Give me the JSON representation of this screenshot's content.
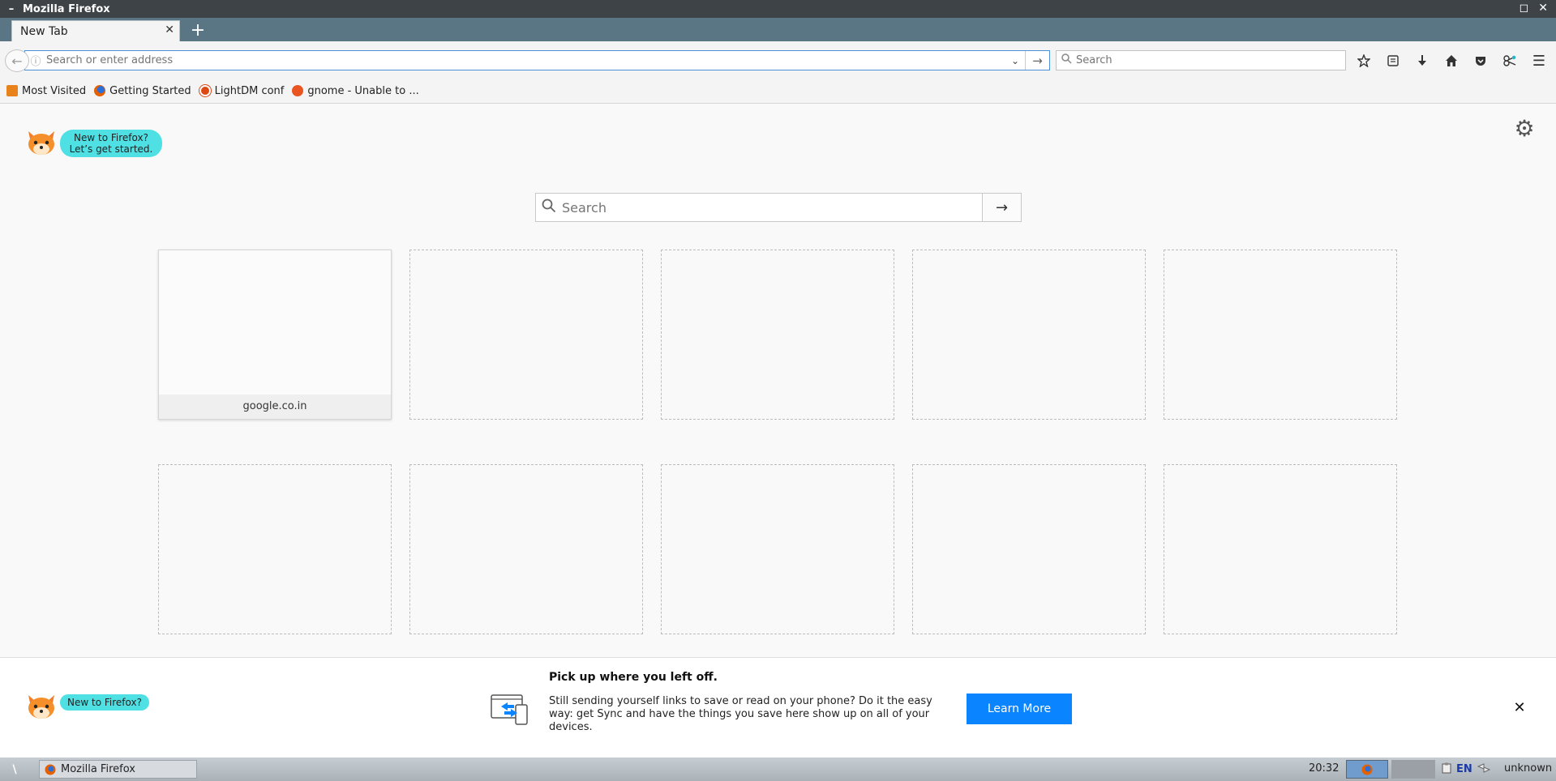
{
  "window": {
    "title": "Mozilla Firefox",
    "menu_glyph": "–",
    "maximize_glyph": "◻",
    "close_glyph": "✕"
  },
  "tabs": [
    {
      "label": "New Tab",
      "close_glyph": "✕"
    }
  ],
  "new_tab_glyph": "+",
  "navbar": {
    "back_glyph": "←",
    "url_placeholder": "Search or enter address",
    "url_value": "",
    "go_glyph": "→",
    "search_placeholder": "Search",
    "tools": [
      "bookmark-star-icon",
      "reading-list-icon",
      "downloads-icon",
      "home-icon",
      "pocket-icon",
      "extension-icon"
    ],
    "menu_glyph": "☰"
  },
  "bookmarks": [
    {
      "label": "Most Visited",
      "icon": "most-visited-icon",
      "color": "#e8831c"
    },
    {
      "label": "Getting Started",
      "icon": "firefox-icon",
      "color": "#e66000"
    },
    {
      "label": "LightDM conf",
      "icon": "ubuntu-icon",
      "color": "#dd4814"
    },
    {
      "label": "gnome - Unable to ...",
      "icon": "askubuntu-icon",
      "color": "#e95420"
    }
  ],
  "newtab": {
    "onboarding_bubble_line1": "New to Firefox?",
    "onboarding_bubble_line2": "Let’s get started.",
    "search_placeholder": "Search",
    "search_go_glyph": "→",
    "gear_glyph": "⚙",
    "tiles": [
      {
        "label": "google.co.in",
        "filled": true
      },
      {
        "label": "",
        "filled": false
      },
      {
        "label": "",
        "filled": false
      },
      {
        "label": "",
        "filled": false
      },
      {
        "label": "",
        "filled": false
      },
      {
        "label": "",
        "filled": false
      },
      {
        "label": "",
        "filled": false
      },
      {
        "label": "",
        "filled": false
      },
      {
        "label": "",
        "filled": false
      },
      {
        "label": "",
        "filled": false
      }
    ]
  },
  "notification": {
    "bubble": "New to Firefox?",
    "heading": "Pick up where you left off.",
    "body": "Still sending yourself links to save or read on your phone? Do it the easy way: get Sync and have the things you save here show up on all of your devices.",
    "button": "Learn More",
    "close_glyph": "✕"
  },
  "taskbar": {
    "launcher_glyph": "\\",
    "task_label": "Mozilla Firefox",
    "clock": "20:32",
    "lang": "EN",
    "user": "unknown"
  },
  "colors": {
    "accent": "#0a84ff",
    "bubble": "#4fe0e4",
    "tabstrip": "#5a7684",
    "titlebar": "#3e4347"
  }
}
